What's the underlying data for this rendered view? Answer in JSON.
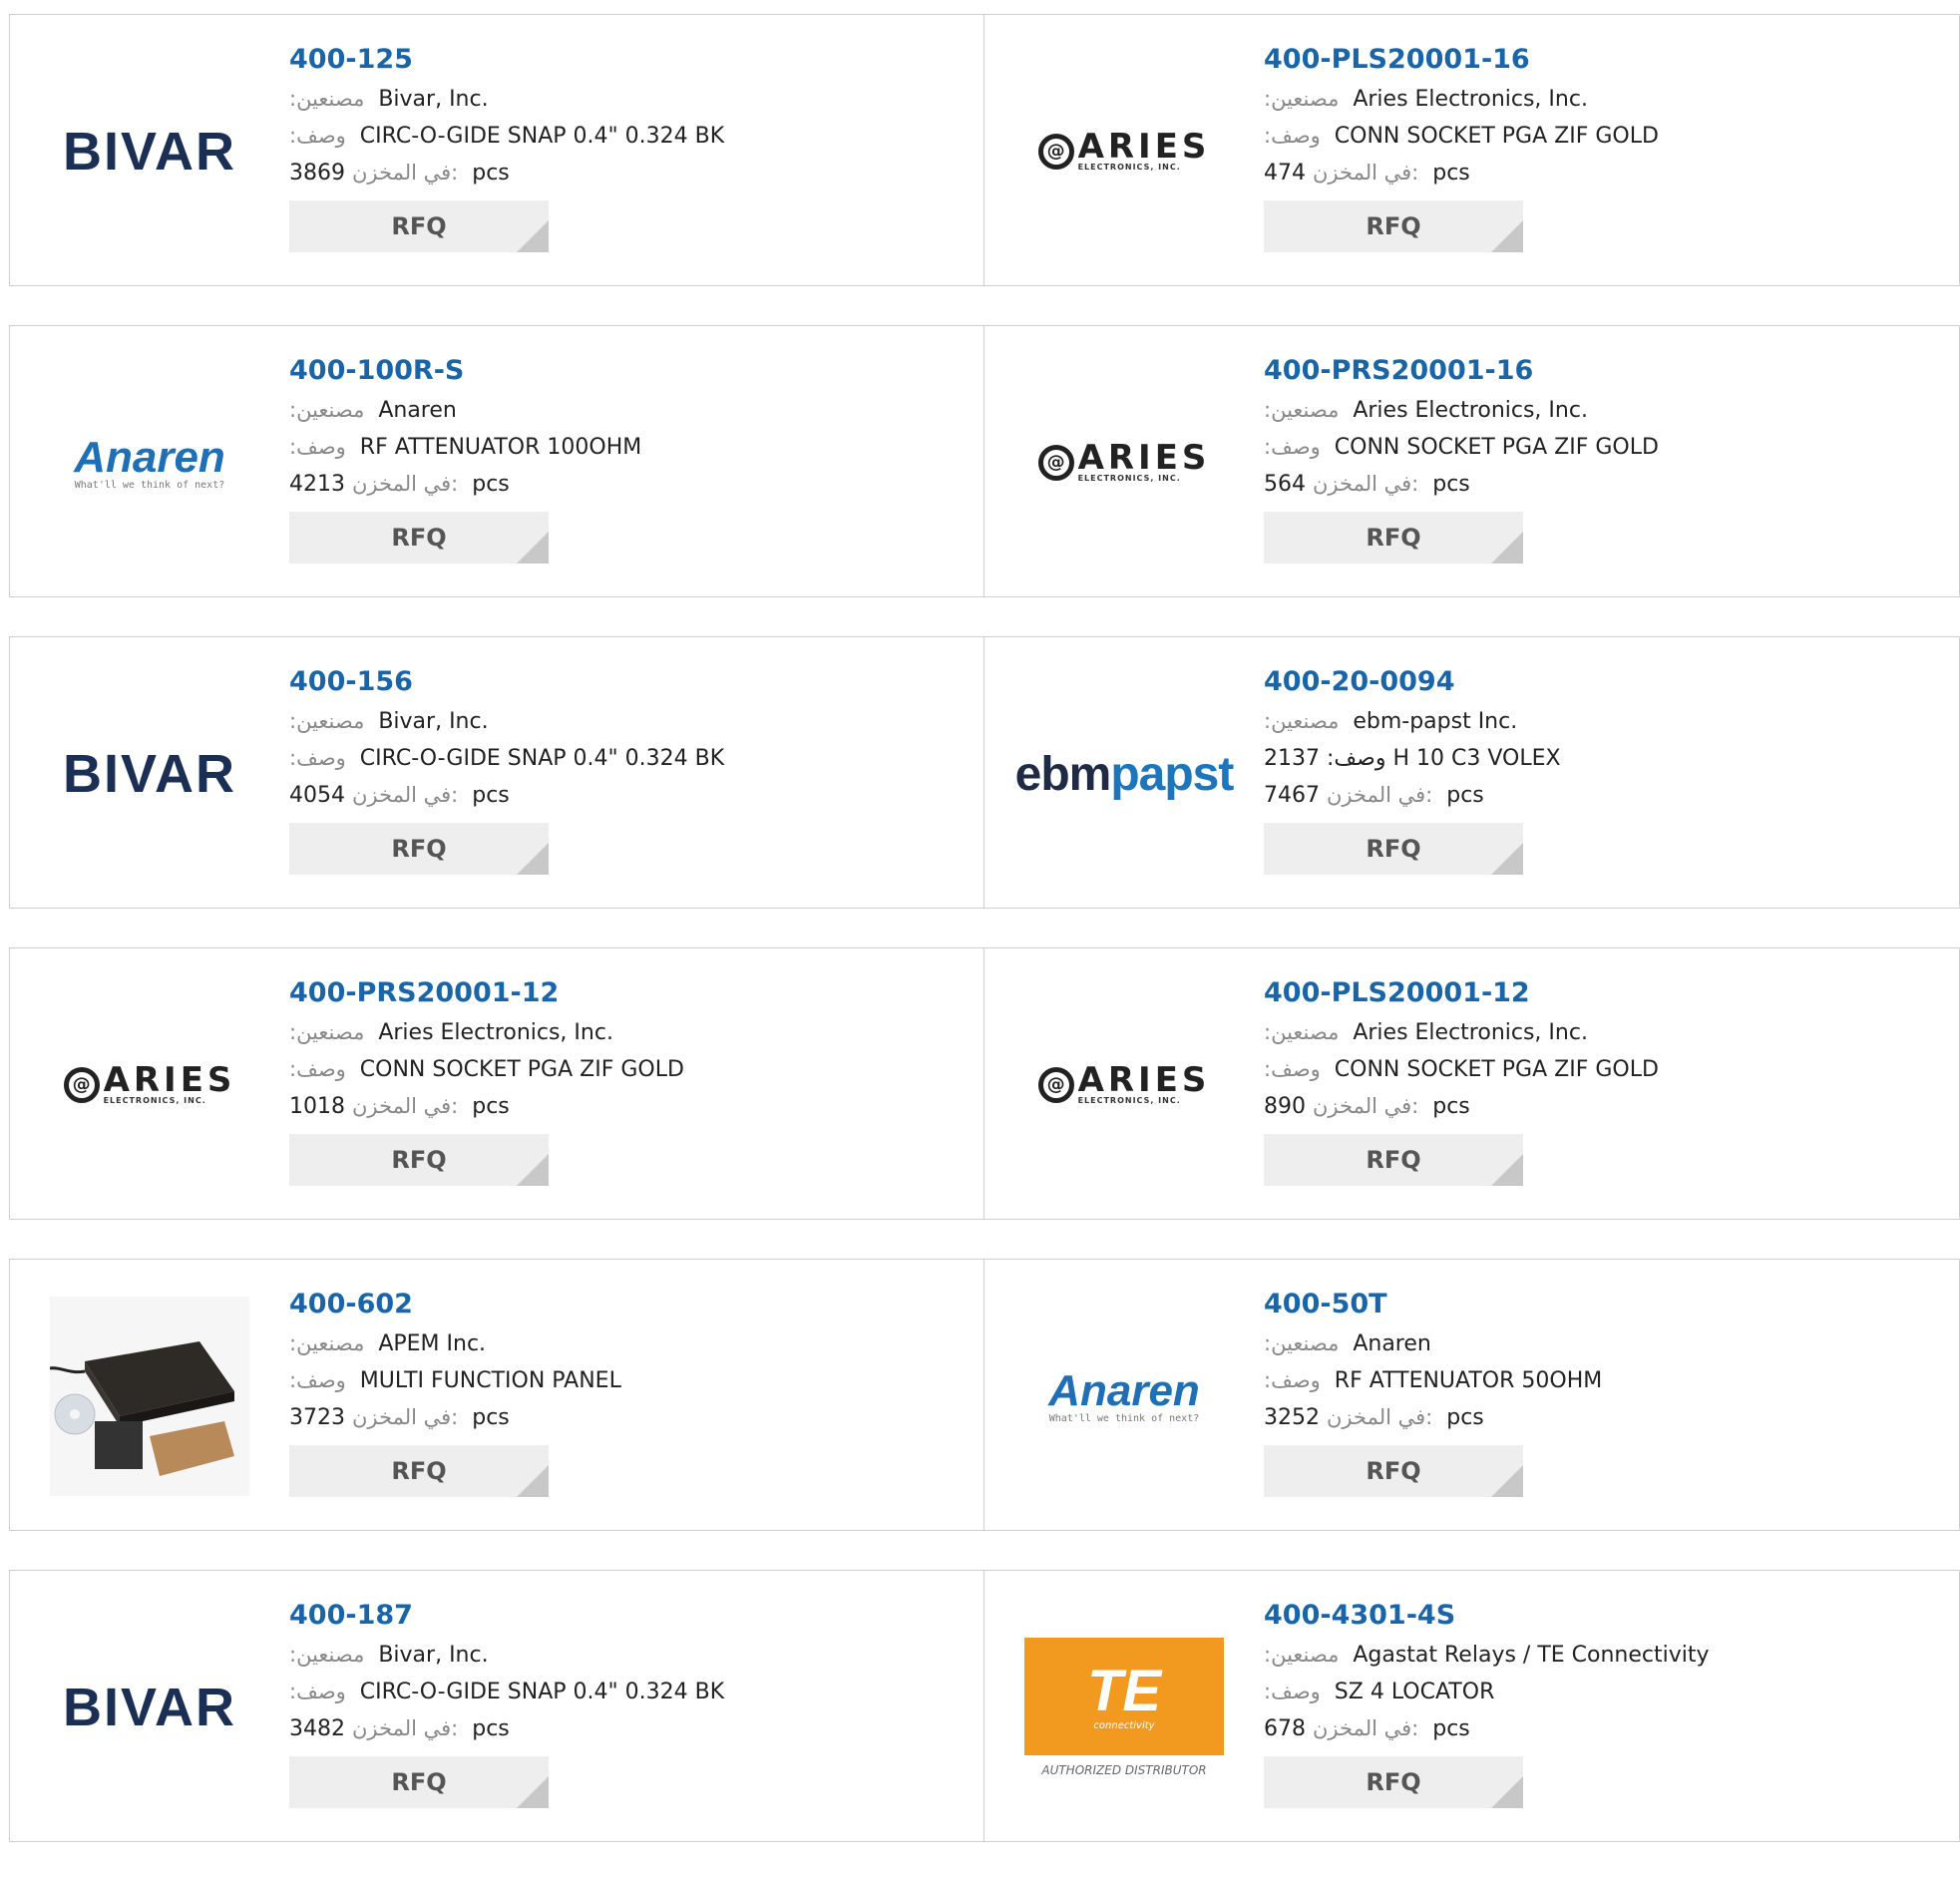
{
  "labels": {
    "manufacturer": ":مصنعين",
    "description": ":وصف",
    "stock": "في المخزن:",
    "unit": "pcs",
    "rfq": "RFQ"
  },
  "products": [
    {
      "part": "400-125",
      "manufacturer": "Bivar, Inc.",
      "description": "CIRC-O-GIDE SNAP 0.4\" 0.324 BK",
      "stock": "3869",
      "logo": "bivar",
      "logo_text": "BIVAR"
    },
    {
      "part": "400-PLS20001-16",
      "manufacturer": "Aries Electronics, Inc.",
      "description": "CONN SOCKET PGA ZIF GOLD",
      "stock": "474",
      "logo": "aries",
      "logo_text": "ARIES",
      "logo_sub": "ELECTRONICS, INC."
    },
    {
      "part": "400-100R-S",
      "manufacturer": "Anaren",
      "description": "RF ATTENUATOR 100OHM",
      "stock": "4213",
      "logo": "anaren",
      "logo_text": "Anaren",
      "logo_sub": "What'll we think of next?"
    },
    {
      "part": "400-PRS20001-16",
      "manufacturer": "Aries Electronics, Inc.",
      "description": "CONN SOCKET PGA ZIF GOLD",
      "stock": "564",
      "logo": "aries",
      "logo_text": "ARIES",
      "logo_sub": "ELECTRONICS, INC."
    },
    {
      "part": "400-156",
      "manufacturer": "Bivar, Inc.",
      "description": "CIRC-O-GIDE SNAP 0.4\" 0.324 BK",
      "stock": "4054",
      "logo": "bivar",
      "logo_text": "BIVAR"
    },
    {
      "part": "400-20-0094",
      "manufacturer": "ebm-papst Inc.",
      "description": "2137 :وصف H 10 C3 VOLEX",
      "stock": "7467",
      "logo": "ebmpapst",
      "logo_text_1": "ebm",
      "logo_text_2": "papst"
    },
    {
      "part": "400-PRS20001-12",
      "manufacturer": "Aries Electronics, Inc.",
      "description": "CONN SOCKET PGA ZIF GOLD",
      "stock": "1018",
      "logo": "aries",
      "logo_text": "ARIES",
      "logo_sub": "ELECTRONICS, INC."
    },
    {
      "part": "400-PLS20001-12",
      "manufacturer": "Aries Electronics, Inc.",
      "description": "CONN SOCKET PGA ZIF GOLD",
      "stock": "890",
      "logo": "aries",
      "logo_text": "ARIES",
      "logo_sub": "ELECTRONICS, INC."
    },
    {
      "part": "400-602",
      "manufacturer": "APEM Inc.",
      "description": "MULTI FUNCTION PANEL",
      "stock": "3723",
      "logo": "product-photo"
    },
    {
      "part": "400-50T",
      "manufacturer": "Anaren",
      "description": "RF ATTENUATOR 50OHM",
      "stock": "3252",
      "logo": "anaren",
      "logo_text": "Anaren",
      "logo_sub": "What'll we think of next?"
    },
    {
      "part": "400-187",
      "manufacturer": "Bivar, Inc.",
      "description": "CIRC-O-GIDE SNAP 0.4\" 0.324 BK",
      "stock": "3482",
      "logo": "bivar",
      "logo_text": "BIVAR"
    },
    {
      "part": "400-4301-4S",
      "manufacturer": "Agastat Relays / TE Connectivity",
      "description": "SZ 4 LOCATOR",
      "stock": "678",
      "logo": "te",
      "logo_text": "TE",
      "logo_sub": "connectivity",
      "logo_auth": "AUTHORIZED DISTRIBUTOR"
    }
  ],
  "colors": {
    "part_link": "#1a64a8",
    "rfq_bg": "#eeeeee",
    "border": "#cfcfcf"
  }
}
